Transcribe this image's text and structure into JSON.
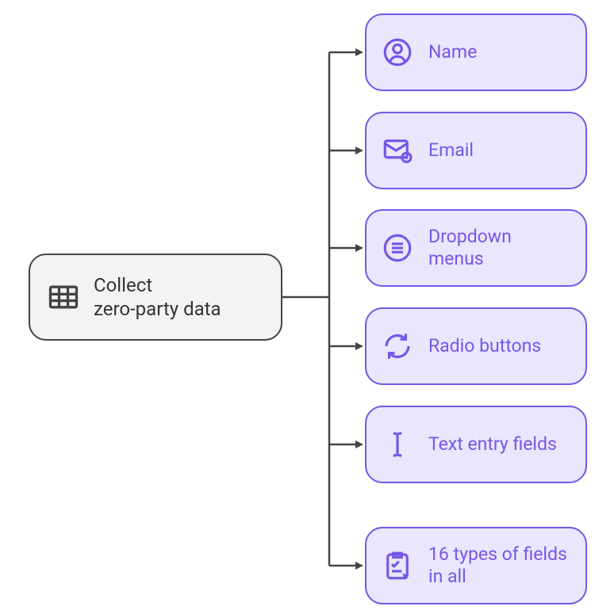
{
  "root": {
    "label": "Collect\nzero-party data",
    "icon": "table-icon"
  },
  "leaves": [
    {
      "label": "Name",
      "icon": "person-icon"
    },
    {
      "label": "Email",
      "icon": "envelope-icon"
    },
    {
      "label": "Dropdown menus",
      "icon": "list-icon"
    },
    {
      "label": "Radio buttons",
      "icon": "refresh-icon"
    },
    {
      "label": "Text entry fields",
      "icon": "text-cursor-icon"
    },
    {
      "label": "16 types of fields in all",
      "icon": "checklist-icon"
    }
  ],
  "colors": {
    "root_bg": "#f3f3f3",
    "root_border": "#444444",
    "leaf_bg": "#eae6fd",
    "leaf_border": "#7557e6",
    "leaf_text": "#7557e6"
  }
}
